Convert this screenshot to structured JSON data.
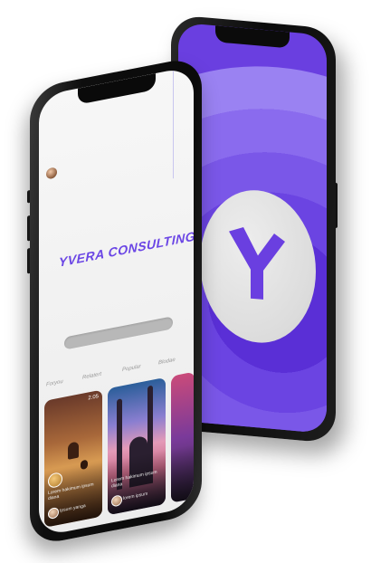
{
  "brand": {
    "name": "YVERA CONSULTING",
    "logo_letter": "Y",
    "accent_color": "#6a45e5"
  },
  "feed": {
    "tabs": [
      "Foryou",
      "Relatert",
      "Popular",
      "Blodae"
    ],
    "cards": [
      {
        "count": "2.05",
        "caption": "Lorem hakimum ipsum diana",
        "author": "Ipsum yanga"
      },
      {
        "count": "",
        "caption": "Lorem hakimum ipsum diana",
        "author": "lorem ipsum"
      }
    ]
  }
}
